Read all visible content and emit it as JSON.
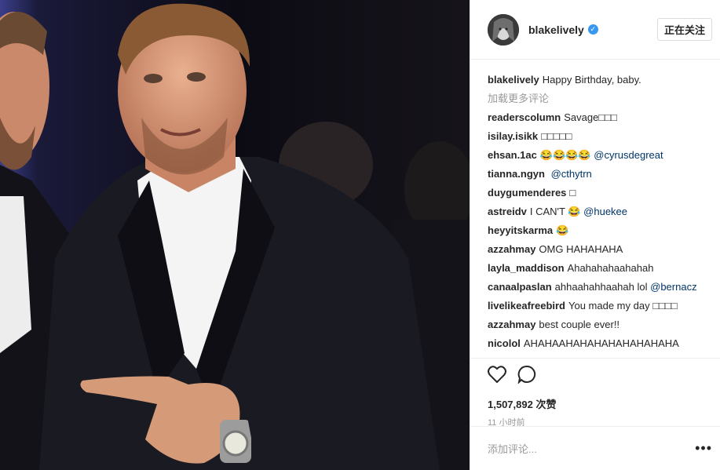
{
  "header": {
    "username": "blakelively",
    "follow_label": "正在关注"
  },
  "caption": {
    "user": "blakelively",
    "text": "Happy Birthday, baby."
  },
  "load_more": "加载更多评论",
  "comments": [
    {
      "user": "readerscolumn",
      "text": "Savage□□□",
      "tag": ""
    },
    {
      "user": "isilay.isikk",
      "text": "□□□□□",
      "tag": ""
    },
    {
      "user": "ehsan.1ac",
      "text": "😂😂😂😂",
      "tag": "@cyrusdegreat"
    },
    {
      "user": "tianna.ngyn",
      "text": "",
      "tag": "@cthytrn"
    },
    {
      "user": "duygumenderes",
      "text": "□",
      "tag": ""
    },
    {
      "user": "astreidv",
      "text": "I CAN'T 😂",
      "tag": "@huekee"
    },
    {
      "user": "heyyitskarma",
      "text": "😂",
      "tag": ""
    },
    {
      "user": "azzahmay",
      "text": "OMG HAHAHAHA",
      "tag": ""
    },
    {
      "user": "layla_maddison",
      "text": "Ahahahahaahahah",
      "tag": ""
    },
    {
      "user": "canaalpaslan",
      "text": "ahhaahahhaahah lol",
      "tag": "@bernacz"
    },
    {
      "user": "livelikeafreebird",
      "text": "You made my day □□□□",
      "tag": ""
    },
    {
      "user": "azzahmay",
      "text": "best couple ever!!",
      "tag": ""
    },
    {
      "user": "nicolol",
      "text": "AHAHAAHAHAHAHAHAHAHAHA",
      "tag": ""
    }
  ],
  "likes": "1,507,892 次赞",
  "timestamp": "11 小时前",
  "add_comment_placeholder": "添加评论...",
  "icons": [
    "heart-icon",
    "comment-icon",
    "more-dots-icon",
    "verified-icon"
  ],
  "colors": {
    "link": "#003569",
    "verified": "#3897f0",
    "muted": "#999999"
  }
}
